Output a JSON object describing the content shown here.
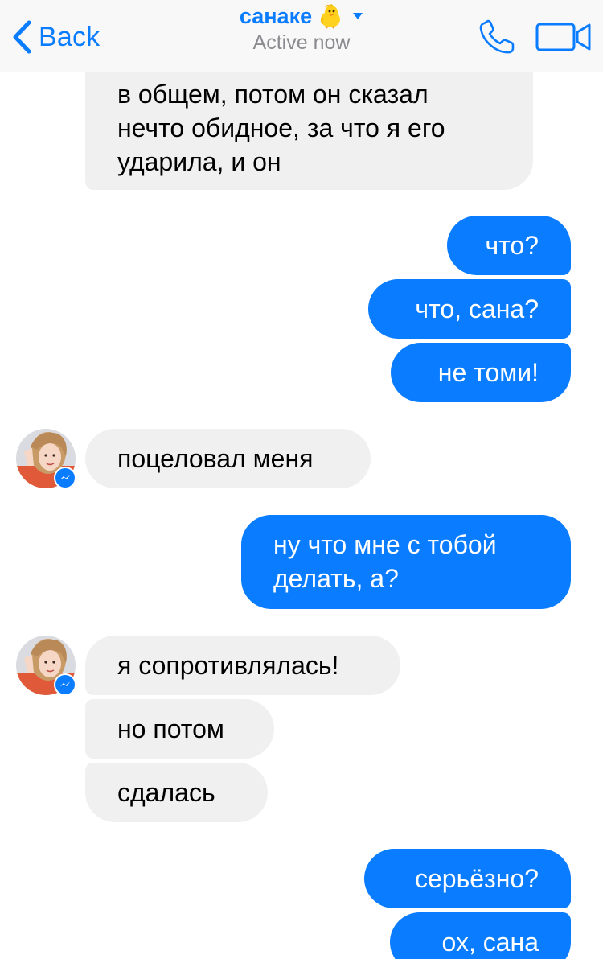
{
  "header": {
    "back_label": "Back",
    "contact_name": "санаке",
    "status": "Active now",
    "icons": {
      "back": "chevron-left-icon",
      "emoji": "baby-chick-emoji-icon",
      "caret": "caret-down-icon",
      "call": "phone-icon",
      "video": "video-camera-icon"
    },
    "accent_color": "#0a7cff"
  },
  "messages": [
    {
      "sender": "contact",
      "text": "в общем, потом он сказал\nнечто обидное, за что я его\nударила, и он"
    },
    {
      "sender": "me",
      "text": "что?"
    },
    {
      "sender": "me",
      "text": "что, сана?"
    },
    {
      "sender": "me",
      "text": "не томи!"
    },
    {
      "sender": "contact",
      "text": "поцеловал меня"
    },
    {
      "sender": "me",
      "text": "ну что мне с тобой\nделать, а?"
    },
    {
      "sender": "contact",
      "text": "я сопротивлялась!"
    },
    {
      "sender": "contact",
      "text": "но потом"
    },
    {
      "sender": "contact",
      "text": "сдалась"
    },
    {
      "sender": "me",
      "text": "серьёзно?"
    },
    {
      "sender": "me",
      "text": "ох, сана"
    }
  ],
  "colors": {
    "incoming_bubble": "#f1f0f0",
    "outgoing_bubble": "#0a7cff",
    "header_background": "#f8f8f9",
    "status_gray": "#8a8a8f"
  }
}
